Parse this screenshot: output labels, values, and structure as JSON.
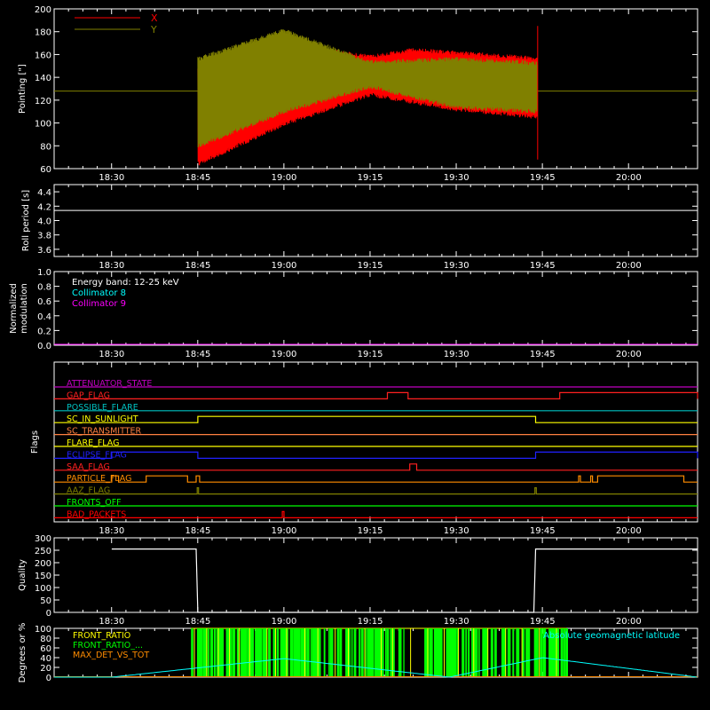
{
  "time_ticks": [
    "18:30",
    "18:45",
    "19:00",
    "19:15",
    "19:30",
    "19:45",
    "20:00"
  ],
  "chart_data": [
    {
      "type": "line",
      "panel": "pointing",
      "ylabel": "Pointing [\"]",
      "ylim": [
        60,
        200
      ],
      "yticks": [
        60,
        80,
        100,
        120,
        140,
        160,
        180,
        200
      ],
      "legend_position": "top-left",
      "series": [
        {
          "name": "X",
          "color": "#ff0000",
          "envelope_upper": [
            [
              18.75,
              150
            ],
            [
              19.0,
              170
            ],
            [
              19.25,
              160
            ],
            [
              19.375,
              166
            ],
            [
              19.75,
              158
            ]
          ],
          "envelope_lower": [
            [
              18.75,
              62
            ],
            [
              19.0,
              97
            ],
            [
              19.25,
              123
            ],
            [
              19.5,
              110
            ],
            [
              19.75,
              103
            ]
          ]
        },
        {
          "name": "Y",
          "color": "#808000",
          "baseline": 128,
          "envelope_upper": [
            [
              18.75,
              158
            ],
            [
              19.0,
              183
            ],
            [
              19.25,
              155
            ],
            [
              19.5,
              158
            ],
            [
              19.75,
              154
            ]
          ],
          "envelope_lower": [
            [
              18.75,
              78
            ],
            [
              19.0,
              108
            ],
            [
              19.25,
              130
            ],
            [
              19.5,
              112
            ],
            [
              19.75,
              108
            ]
          ]
        }
      ]
    },
    {
      "type": "line",
      "panel": "roll_period",
      "ylabel": "Roll period [s]",
      "ylim": [
        3.5,
        4.5
      ],
      "yticks": [
        "3.6",
        "3.8",
        "4.0",
        "4.2",
        "4.4"
      ],
      "series": [
        {
          "color": "#ffffff",
          "constant": 4.14
        }
      ]
    },
    {
      "type": "line",
      "panel": "modulation",
      "ylabel": [
        "Normalized",
        "modulation"
      ],
      "ylim": [
        0,
        1
      ],
      "yticks": [
        "0.0",
        "0.2",
        "0.4",
        "0.6",
        "0.8",
        "1.0"
      ],
      "annotation": "Energy band: 12-25 keV",
      "series": [
        {
          "name": "Collimator 8",
          "color": "#00ffff"
        },
        {
          "name": "Collimator 9",
          "color": "#ff00ff",
          "constant": 0
        }
      ]
    },
    {
      "type": "line",
      "panel": "flags",
      "ylabel": "Flags",
      "flags": [
        {
          "name": "ATTENUATOR_STATE",
          "color": "#c000c0"
        },
        {
          "name": "GAP_FLAG",
          "color": "#ff2020",
          "high": [
            [
              19.3,
              19.36
            ],
            [
              19.8,
              20.2
            ]
          ]
        },
        {
          "name": "POSSIBLE_FLARE",
          "color": "#00c0c0"
        },
        {
          "name": "SC_IN_SUNLIGHT",
          "color": "#ffff00",
          "high": [
            [
              18.75,
              19.73
            ]
          ]
        },
        {
          "name": "SC_TRANSMITTER",
          "color": "#ff8040"
        },
        {
          "name": "FLARE_FLAG",
          "color": "#ffff00"
        },
        {
          "name": "ECLIPSE_FLAG",
          "color": "#2020ff",
          "high": [
            [
              18.5,
              18.75
            ],
            [
              19.73,
              20.2
            ]
          ]
        },
        {
          "name": "SAA_FLAG",
          "color": "#ff2020",
          "high": [
            [
              19.365,
              19.385
            ]
          ]
        },
        {
          "name": "PARTICLE_FLAG",
          "color": "#ff8c00",
          "high": [
            [
              18.5,
              18.52
            ],
            [
              18.6,
              18.72
            ],
            [
              18.745,
              18.755
            ],
            [
              19.855,
              19.86
            ],
            [
              19.89,
              19.895
            ],
            [
              19.91,
              20.16
            ]
          ]
        },
        {
          "name": "AAZ_FLAG",
          "color": "#808000",
          "high": [
            [
              18.748,
              18.752
            ],
            [
              19.728,
              19.732
            ]
          ]
        },
        {
          "name": "FRONTS_OFF",
          "color": "#00ff00"
        },
        {
          "name": "BAD_PACKETS",
          "color": "#ff0000",
          "high": [
            [
              18.995,
              19.0
            ]
          ]
        }
      ]
    },
    {
      "type": "line",
      "panel": "quality",
      "ylabel": "Quality",
      "ylim": [
        0,
        300
      ],
      "yticks": [
        0,
        50,
        100,
        150,
        200,
        250,
        300
      ],
      "series": [
        {
          "color": "#ffffff",
          "points": [
            [
              18.5,
              255
            ],
            [
              18.745,
              255
            ],
            [
              18.75,
              0
            ],
            [
              19.725,
              0
            ],
            [
              19.73,
              255
            ],
            [
              20.2,
              255
            ]
          ]
        }
      ]
    },
    {
      "type": "line",
      "panel": "ratios",
      "ylabel": "Degrees or %",
      "ylim": [
        0,
        100
      ],
      "yticks": [
        0,
        20,
        40,
        60,
        80,
        100
      ],
      "annotation": "Absolute geomagnetic latitude",
      "series": [
        {
          "name": "FRONT_RATIO",
          "color": "#ffff00"
        },
        {
          "name": "FRONT_RATIO_...",
          "color": "#00ff00"
        },
        {
          "name": "MAX_DET_VS_TOT",
          "color": "#ff8c00"
        },
        {
          "name": "Absolute geomagnetic latitude",
          "color": "#00ffff",
          "points": [
            [
              18.5,
              0
            ],
            [
              19.0,
              38
            ],
            [
              19.48,
              0
            ],
            [
              19.75,
              40
            ],
            [
              20.2,
              0
            ]
          ]
        }
      ]
    }
  ]
}
